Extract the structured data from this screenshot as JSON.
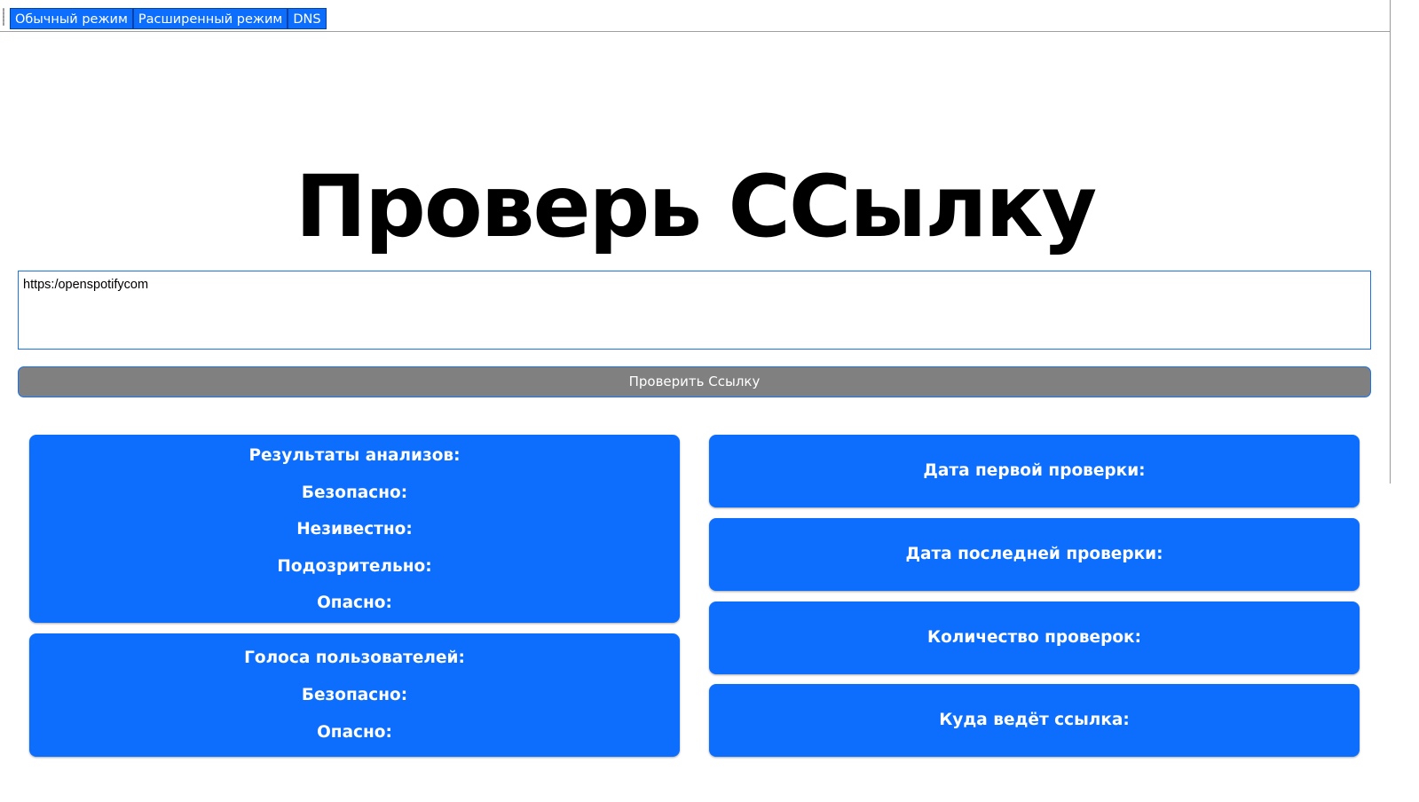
{
  "tabs": [
    "Обычный режим",
    "Расширенный режим",
    "DNS"
  ],
  "logo": {
    "text": "Проверь ССылку"
  },
  "url_input": {
    "value": "https:/openspotifycom"
  },
  "check_button": {
    "label": "Проверить Ссылку"
  },
  "analysis_panel": {
    "title": "Результаты анализов:",
    "rows": [
      "Безопасно:",
      "Незивестно:",
      "Подозрительно:",
      "Опасно:"
    ]
  },
  "votes_panel": {
    "title": "Голоса пользователей:",
    "rows": [
      "Безопасно:",
      "Опасно:"
    ]
  },
  "info_panels": [
    "Дата первой проверки:",
    "Дата последней проверки:",
    "Количество проверок:",
    "Куда ведёт ссылка:"
  ],
  "colors": {
    "accent": "#0d6efd",
    "button_bg": "#808080",
    "border": "#1a73e8"
  }
}
